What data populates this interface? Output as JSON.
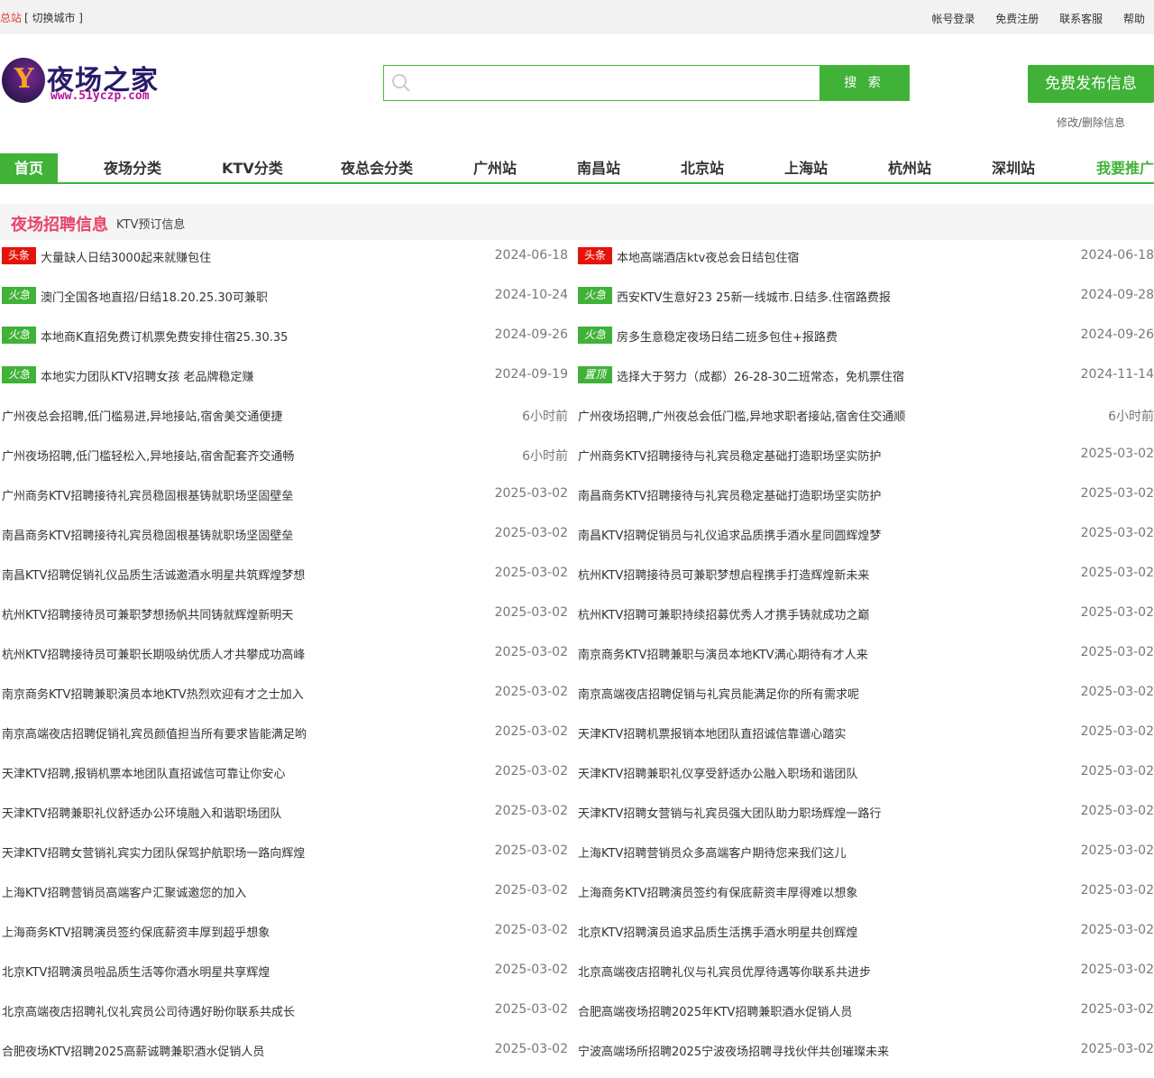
{
  "topbar": {
    "home": "总站",
    "switch_city": "[ 切换城市 ]",
    "links": [
      "帐号登录",
      "免费注册",
      "联系客服",
      "帮助"
    ]
  },
  "logo": {
    "name": "夜场之家",
    "url": "www.51yczp.com"
  },
  "search": {
    "placeholder": "",
    "button": "搜 索"
  },
  "publish": {
    "button": "免费发布信息",
    "modify": "修改/删除信息"
  },
  "nav": [
    "首页",
    "夜场分类",
    "KTV分类",
    "夜总会分类",
    "广州站",
    "南昌站",
    "北京站",
    "上海站",
    "杭州站",
    "深圳站",
    "我要推广"
  ],
  "section": {
    "title": "夜场招聘信息",
    "subtitle": "KTV预订信息"
  },
  "left_list": [
    {
      "tag": "头条",
      "tag_color": "#e4140a",
      "text": "大量缺人日结3000起来就赚包住",
      "date": "2024-06-18"
    },
    {
      "tag": "火急",
      "tag_color": "#3fb237",
      "text": "澳门全国各地直招/日结18.20.25.30可兼职",
      "date": "2024-10-24"
    },
    {
      "tag": "火急",
      "tag_color": "#3fb237",
      "text": "本地商K直招免费订机票免费安排住宿25.30.35",
      "date": "2024-09-26"
    },
    {
      "tag": "火急",
      "tag_color": "#3fb237",
      "text": "本地实力团队KTV招聘女孩 老品牌稳定赚",
      "date": "2024-09-19"
    },
    {
      "tag": "",
      "text": "广州夜总会招聘,低门槛易进,异地接站,宿舍美交通便捷",
      "date": "6小时前"
    },
    {
      "tag": "",
      "text": "广州夜场招聘,低门槛轻松入,异地接站,宿舍配套齐交通畅",
      "date": "6小时前"
    },
    {
      "tag": "",
      "text": "广州商务KTV招聘接待礼宾员稳固根基铸就职场坚固壁垒",
      "date": "2025-03-02"
    },
    {
      "tag": "",
      "text": "南昌商务KTV招聘接待礼宾员稳固根基铸就职场坚固壁垒",
      "date": "2025-03-02"
    },
    {
      "tag": "",
      "text": "南昌KTV招聘促销礼仪品质生活诚邀酒水明星共筑辉煌梦想",
      "date": "2025-03-02"
    },
    {
      "tag": "",
      "text": "杭州KTV招聘接待员可兼职梦想扬帆共同铸就辉煌新明天",
      "date": "2025-03-02"
    },
    {
      "tag": "",
      "text": "杭州KTV招聘接待员可兼职长期吸纳优质人才共攀成功高峰",
      "date": "2025-03-02"
    },
    {
      "tag": "",
      "text": "南京商务KTV招聘兼职演员本地KTV热烈欢迎有才之士加入",
      "date": "2025-03-02"
    },
    {
      "tag": "",
      "text": "南京高端夜店招聘促销礼宾员颜值担当所有要求皆能满足哟",
      "date": "2025-03-02"
    },
    {
      "tag": "",
      "text": "天津KTV招聘,报销机票本地团队直招诚信可靠让你安心",
      "date": "2025-03-02"
    },
    {
      "tag": "",
      "text": "天津KTV招聘兼职礼仪舒适办公环境融入和谐职场团队",
      "date": "2025-03-02"
    },
    {
      "tag": "",
      "text": "天津KTV招聘女营销礼宾实力团队保驾护航职场一路向辉煌",
      "date": "2025-03-02"
    },
    {
      "tag": "",
      "text": "上海KTV招聘营销员高端客户汇聚诚邀您的加入",
      "date": "2025-03-02"
    },
    {
      "tag": "",
      "text": "上海商务KTV招聘演员签约保底薪资丰厚到超乎想象",
      "date": "2025-03-02"
    },
    {
      "tag": "",
      "text": "北京KTV招聘演员啦品质生活等你酒水明星共享辉煌",
      "date": "2025-03-02"
    },
    {
      "tag": "",
      "text": "北京高端夜店招聘礼仪礼宾员公司待遇好盼你联系共成长",
      "date": "2025-03-02"
    },
    {
      "tag": "",
      "text": "合肥夜场KTV招聘2025高薪诚聘兼职酒水促销人员",
      "date": "2025-03-02"
    }
  ],
  "right_list": [
    {
      "tag": "头条",
      "tag_color": "#e4140a",
      "text": "本地高端酒店ktv夜总会日结包住宿",
      "date": "2024-06-18"
    },
    {
      "tag": "火急",
      "tag_color": "#3fb237",
      "text": "西安KTV生意好23 25新一线城市.日结多.住宿路费报",
      "date": "2024-09-28"
    },
    {
      "tag": "火急",
      "tag_color": "#3fb237",
      "text": "房多生意稳定夜场日结二班多包住+报路费",
      "date": "2024-09-26"
    },
    {
      "tag": "置顶",
      "tag_color": "#3fb237",
      "text": "选择大于努力（成都）26-28-30二班常态，免机票住宿",
      "date": "2024-11-14"
    },
    {
      "tag": "",
      "text": "广州夜场招聘,广州夜总会低门槛,异地求职者接站,宿舍住交通顺",
      "date": "6小时前"
    },
    {
      "tag": "",
      "text": "广州商务KTV招聘接待与礼宾员稳定基础打造职场坚实防护",
      "date": "2025-03-02"
    },
    {
      "tag": "",
      "text": "南昌商务KTV招聘接待与礼宾员稳定基础打造职场坚实防护",
      "date": "2025-03-02"
    },
    {
      "tag": "",
      "text": "南昌KTV招聘促销员与礼仪追求品质携手酒水星同圆辉煌梦",
      "date": "2025-03-02"
    },
    {
      "tag": "",
      "text": "杭州KTV招聘接待员可兼职梦想启程携手打造辉煌新未来",
      "date": "2025-03-02"
    },
    {
      "tag": "",
      "text": "杭州KTV招聘可兼职持续招募优秀人才携手铸就成功之巅",
      "date": "2025-03-02"
    },
    {
      "tag": "",
      "text": "南京商务KTV招聘兼职与演员本地KTV满心期待有才人来",
      "date": "2025-03-02"
    },
    {
      "tag": "",
      "text": "南京高端夜店招聘促销与礼宾员能满足你的所有需求呢",
      "date": "2025-03-02"
    },
    {
      "tag": "",
      "text": "天津KTV招聘机票报销本地团队直招诚信靠谱心踏实",
      "date": "2025-03-02"
    },
    {
      "tag": "",
      "text": "天津KTV招聘兼职礼仪享受舒适办公融入职场和谐团队",
      "date": "2025-03-02"
    },
    {
      "tag": "",
      "text": "天津KTV招聘女营销与礼宾员强大团队助力职场辉煌一路行",
      "date": "2025-03-02"
    },
    {
      "tag": "",
      "text": "上海KTV招聘营销员众多高端客户期待您来我们这儿",
      "date": "2025-03-02"
    },
    {
      "tag": "",
      "text": "上海商务KTV招聘演员签约有保底薪资丰厚得难以想象",
      "date": "2025-03-02"
    },
    {
      "tag": "",
      "text": "北京KTV招聘演员追求品质生活携手酒水明星共创辉煌",
      "date": "2025-03-02"
    },
    {
      "tag": "",
      "text": "北京高端夜店招聘礼仪与礼宾员优厚待遇等你联系共进步",
      "date": "2025-03-02"
    },
    {
      "tag": "",
      "text": "合肥高端夜场招聘2025年KTV招聘兼职酒水促销人员",
      "date": "2025-03-02"
    },
    {
      "tag": "",
      "text": "宁波高端场所招聘2025宁波夜场招聘寻找伙伴共创璀璨未来",
      "date": "2025-03-02"
    }
  ]
}
